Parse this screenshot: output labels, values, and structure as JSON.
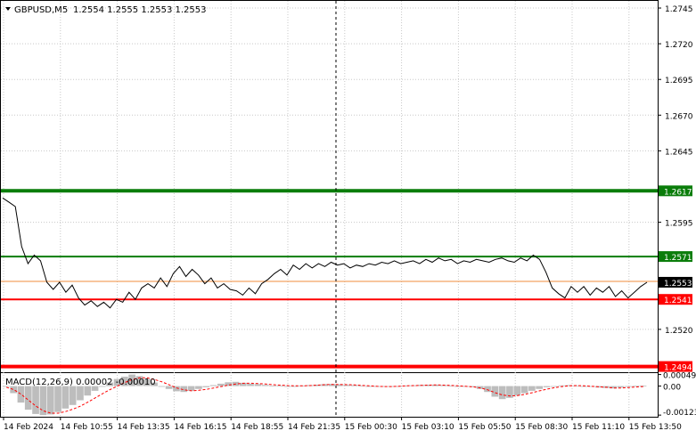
{
  "header": {
    "symbol": "GBPUSD,M5",
    "ohlc": "1.2554 1.2555 1.2553 1.2553"
  },
  "macd": {
    "label": "MACD(12,26,9) 0.00002 -0.00010",
    "axis_labels": [
      "0.00049",
      "0.00",
      "-0.00123"
    ]
  },
  "colors": {
    "background": "#ffffff",
    "price_line": "#000000",
    "grid": "#c8c8c8",
    "support_resistance_green": "#0a7d0a",
    "support_resistance_red": "#ff0000",
    "bid_line": "#f08c3c",
    "macd_histogram": "#bdbdbd",
    "macd_signal": "#ff0000"
  },
  "chart_data": {
    "type": "line",
    "title": "",
    "y_axis": {
      "ticks": [
        "1.2745",
        "1.2720",
        "1.2695",
        "1.2670",
        "1.2645",
        "1.2595",
        "1.2520"
      ],
      "ylim": [
        1.249,
        1.275
      ]
    },
    "x_axis": {
      "ticks": [
        "14 Feb 2024",
        "14 Feb 10:55",
        "14 Feb 13:35",
        "14 Feb 16:15",
        "14 Feb 18:55",
        "14 Feb 21:35",
        "15 Feb 00:30",
        "15 Feb 03:10",
        "15 Feb 05:50",
        "15 Feb 08:30",
        "15 Feb 11:10",
        "15 Feb 13:50"
      ]
    },
    "levels": [
      {
        "value": 1.2617,
        "label": "1.2617",
        "color": "#0a7d0a"
      },
      {
        "value": 1.2571,
        "label": "1.2571",
        "color": "#0a7d0a"
      },
      {
        "value": 1.2541,
        "label": "1.2541",
        "color": "#ff0000"
      },
      {
        "value": 1.2494,
        "label": "1.2494",
        "color": "#ff0000"
      }
    ],
    "current_price": {
      "value": 1.2553,
      "label": "1.2553"
    },
    "price_series": [
      1.2612,
      1.2609,
      1.2606,
      1.2578,
      1.2566,
      1.2572,
      1.2568,
      1.2553,
      1.2548,
      1.2553,
      1.2546,
      1.2551,
      1.2542,
      1.2537,
      1.254,
      1.2536,
      1.2539,
      1.2535,
      1.2541,
      1.2539,
      1.2546,
      1.2541,
      1.2549,
      1.2552,
      1.2549,
      1.2556,
      1.255,
      1.2559,
      1.2564,
      1.2557,
      1.2562,
      1.2558,
      1.2552,
      1.2556,
      1.2549,
      1.2552,
      1.2548,
      1.2547,
      1.2544,
      1.2549,
      1.2545,
      1.2552,
      1.2555,
      1.2559,
      1.2562,
      1.2558,
      1.2565,
      1.2562,
      1.2566,
      1.2563,
      1.2566,
      1.2564,
      1.2567,
      1.2565,
      1.2566,
      1.2563,
      1.2565,
      1.2564,
      1.2566,
      1.2565,
      1.2567,
      1.2566,
      1.2568,
      1.2566,
      1.2567,
      1.2568,
      1.2566,
      1.2569,
      1.2567,
      1.257,
      1.2568,
      1.2569,
      1.2566,
      1.2568,
      1.2567,
      1.2569,
      1.2568,
      1.2567,
      1.2569,
      1.257,
      1.2568,
      1.2567,
      1.257,
      1.2568,
      1.2572,
      1.2569,
      1.256,
      1.2549,
      1.2545,
      1.2542,
      1.255,
      1.2546,
      1.255,
      1.2544,
      1.2549,
      1.2546,
      1.255,
      1.2543,
      1.2547,
      1.2542,
      1.2546,
      1.255,
      1.2553
    ],
    "macd_series": {
      "ylim": [
        -0.0013,
        0.00055
      ],
      "histogram": [
        0.0,
        -0.0003,
        -0.0007,
        -0.001,
        -0.00118,
        -0.00123,
        -0.0012,
        -0.0011,
        -0.00095,
        -0.0008,
        -0.0006,
        -0.0004,
        -0.0002,
        0.0,
        0.00015,
        0.0003,
        0.0004,
        0.00049,
        0.00042,
        0.0003,
        0.00015,
        0.0,
        -0.00012,
        -0.00022,
        -0.00025,
        -0.0002,
        -0.00012,
        -5e-05,
        4e-05,
        0.0001,
        0.00016,
        0.00018,
        0.00014,
        0.0001,
        8e-05,
        5e-05,
        2e-05,
        1e-05,
        0.0,
        0.0,
        2e-05,
        4e-05,
        6e-05,
        8e-05,
        9e-05,
        7e-05,
        5e-05,
        4e-05,
        2e-05,
        0.0,
        -2e-05,
        -3e-05,
        -2e-05,
        0.0,
        2e-05,
        3e-05,
        5e-05,
        6e-05,
        6e-05,
        4e-05,
        2e-05,
        0.0,
        -2e-05,
        -4e-05,
        -0.00012,
        -0.00025,
        -0.00045,
        -0.00055,
        -0.0005,
        -0.0004,
        -0.0003,
        -0.0002,
        -0.00012,
        -5e-05,
        0.0,
        3e-05,
        4e-05,
        2e-05,
        0.0,
        -3e-05,
        -6e-05,
        -8e-05,
        -0.0001,
        -6e-05,
        -2e-05,
        1e-05,
        2e-05
      ],
      "signal": [
        -5e-05,
        -0.00015,
        -0.00035,
        -0.0006,
        -0.00085,
        -0.00105,
        -0.00115,
        -0.00115,
        -0.00108,
        -0.00098,
        -0.00085,
        -0.00068,
        -0.0005,
        -0.00032,
        -0.00015,
        0.0,
        0.00015,
        0.00028,
        0.00035,
        0.00035,
        0.00028,
        0.00018,
        5e-05,
        -8e-05,
        -0.00016,
        -0.0002,
        -0.00018,
        -0.00014,
        -8e-05,
        -2e-05,
        4e-05,
        9e-05,
        0.00012,
        0.00012,
        0.00011,
        9e-05,
        6e-05,
        4e-05,
        2e-05,
        1e-05,
        1e-05,
        2e-05,
        4e-05,
        6e-05,
        7e-05,
        7e-05,
        6e-05,
        5e-05,
        3e-05,
        1e-05,
        -1e-05,
        -2e-05,
        -2e-05,
        -1e-05,
        1e-05,
        2e-05,
        3e-05,
        4e-05,
        5e-05,
        4e-05,
        3e-05,
        1e-05,
        -1e-05,
        -3e-05,
        -8e-05,
        -0.00016,
        -0.00028,
        -0.00038,
        -0.00042,
        -0.0004,
        -0.00035,
        -0.00028,
        -0.0002,
        -0.00013,
        -7e-05,
        -2e-05,
        1e-05,
        2e-05,
        1e-05,
        -1e-05,
        -3e-05,
        -5e-05,
        -8e-05,
        -8e-05,
        -6e-05,
        -4e-05,
        -2e-05
      ]
    }
  }
}
